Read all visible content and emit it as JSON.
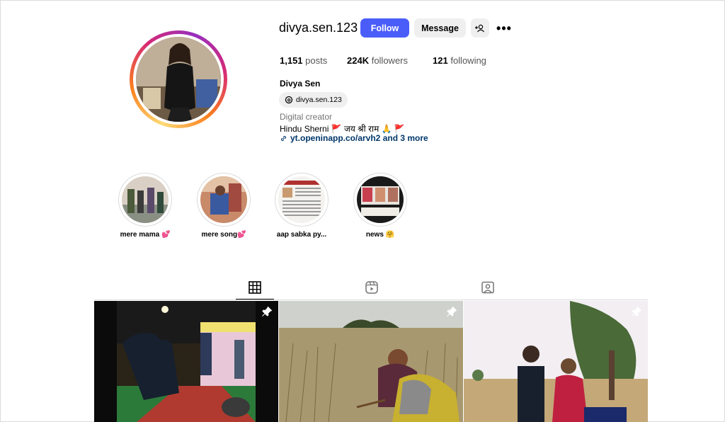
{
  "profile": {
    "username": "divya.sen.123",
    "follow_label": "Follow",
    "message_label": "Message",
    "more_label": "•••",
    "add_user_icon": "add-user-icon",
    "stats": {
      "posts_count": "1,151",
      "posts_label": "posts",
      "followers_count": "224K",
      "followers_label": "followers",
      "following_count": "121",
      "following_label": "following"
    },
    "full_name": "Divya Sen",
    "threads_handle": "divya.sen.123",
    "category": "Digital creator",
    "bio": "Hindu Sherni 🚩 जय श्री राम 🙏 🚩",
    "link": "yt.openinapp.co/arvh2 and 3 more"
  },
  "highlights": [
    {
      "label": "mere mama 💕"
    },
    {
      "label": "mere song💕"
    },
    {
      "label": "aap sabka py..."
    },
    {
      "label": "news 🤗"
    }
  ],
  "tabs": [
    {
      "icon": "grid-icon",
      "active": true
    },
    {
      "icon": "reels-icon",
      "active": false
    },
    {
      "icon": "tagged-icon",
      "active": false
    }
  ],
  "posts": [
    {
      "pinned": true
    },
    {
      "pinned": true
    },
    {
      "pinned": true
    }
  ],
  "colors": {
    "follow_button": "#4a5df9",
    "link": "#00376b",
    "secondary_button": "#efefef"
  }
}
